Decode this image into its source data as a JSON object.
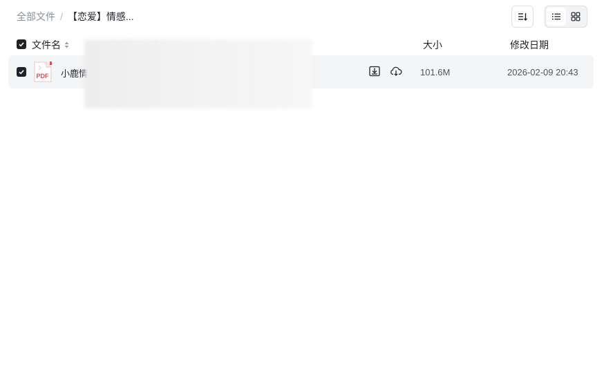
{
  "breadcrumb": {
    "root": "全部文件",
    "separator": "/",
    "current": "【恋爱】情感..."
  },
  "toolbar": {
    "sort_icon": "sort-descending-icon",
    "list_view_icon": "list-view-icon",
    "grid_view_icon": "grid-view-icon",
    "active_view": "list"
  },
  "table": {
    "columns": {
      "name": "文件名",
      "size": "大小",
      "date": "修改日期"
    },
    "all_selected": true,
    "rows": [
      {
        "selected": true,
        "type": "PDF",
        "name": "小鹿情",
        "size": "101.6M",
        "modified": "2026-02-09 20:43",
        "actions": [
          "download-icon",
          "cloud-save-icon"
        ]
      }
    ]
  },
  "colors": {
    "checkbox": "#1f2329",
    "pdf_red": "#e5484d",
    "row_bg": "#f4f5f6",
    "muted_text": "#8a8f99"
  }
}
